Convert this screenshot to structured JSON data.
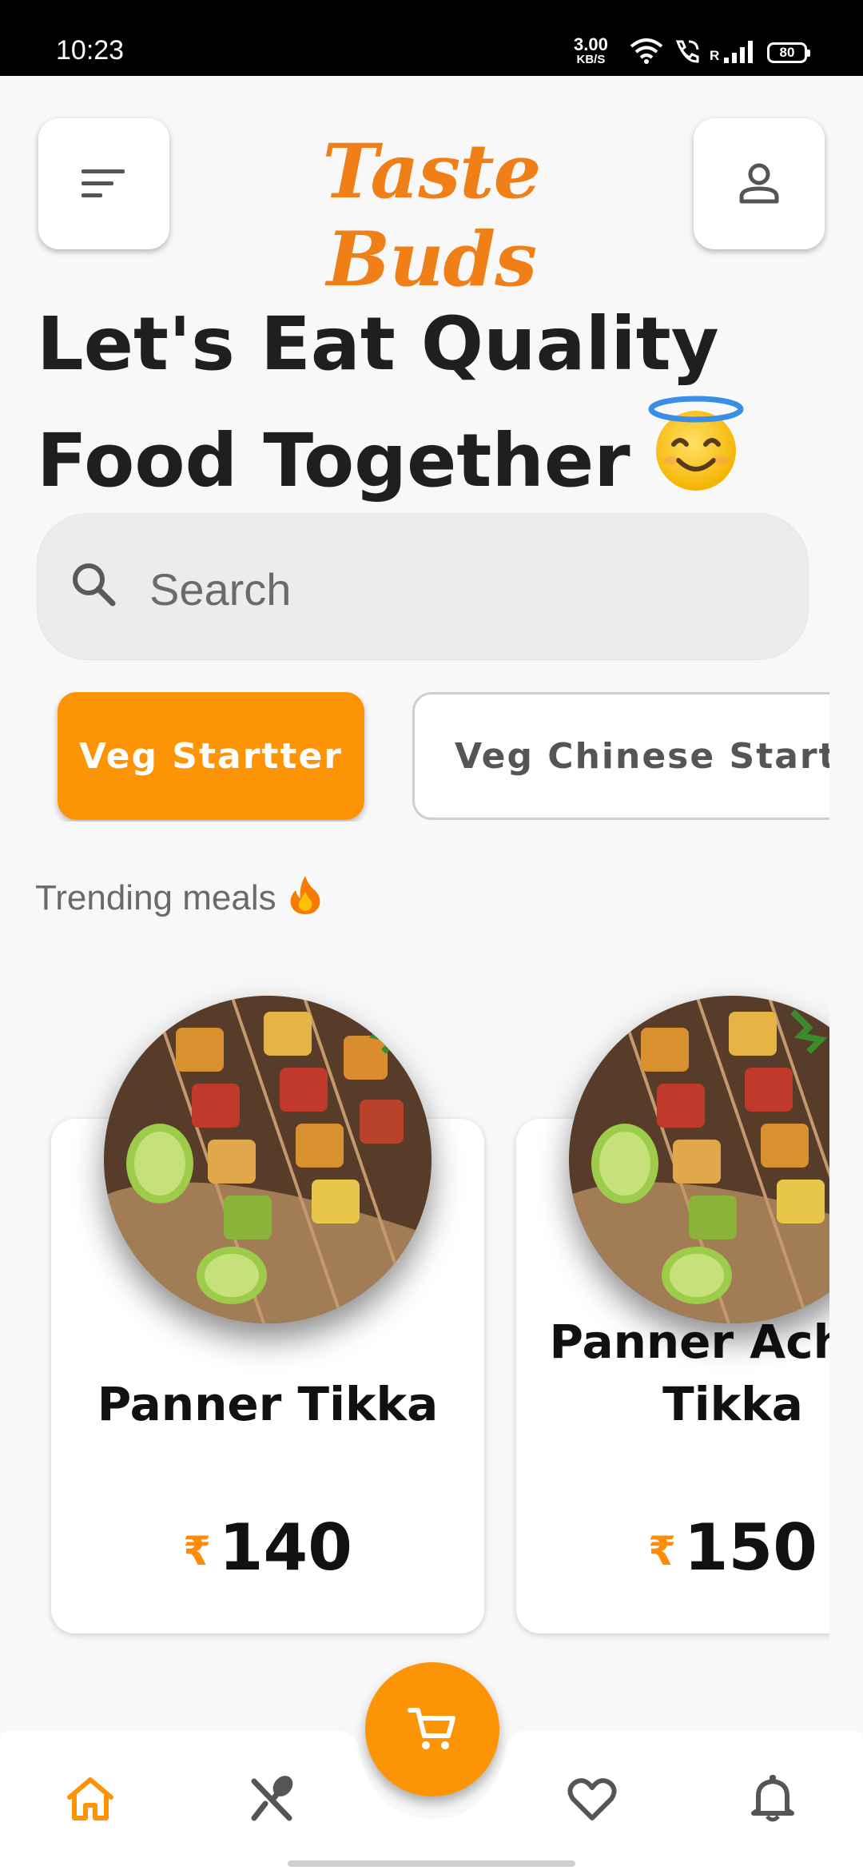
{
  "status_bar": {
    "time": "10:23",
    "net_speed": "3.00",
    "net_unit": "KB/S",
    "signal_label": "R",
    "battery": "80"
  },
  "header": {
    "brand": "Taste Buds",
    "menu_icon": "sort-icon",
    "profile_icon": "person-icon",
    "brand_color": "#f07f17"
  },
  "hero": {
    "line1": "Let's Eat Quality",
    "line2": "Food Together",
    "emoji_icon": "smiling-face-with-halo-icon"
  },
  "search": {
    "placeholder": "Search"
  },
  "categories": [
    {
      "label": "Veg Startter",
      "selected": true
    },
    {
      "label": "Veg Chinese Startter",
      "selected": false
    }
  ],
  "trending": {
    "title": "Trending meals",
    "icon": "fire-icon",
    "meals": [
      {
        "name": "Panner Tikka",
        "currency": "₹",
        "price": "140"
      },
      {
        "name": "Panner Achari Tikka",
        "currency": "₹",
        "price": "150"
      }
    ]
  },
  "bottom_nav": {
    "items": [
      "home-icon",
      "restaurant-icon",
      "cart-icon",
      "favorite-icon",
      "notification-icon"
    ],
    "active": "home-icon",
    "accent": "#fd9406"
  }
}
